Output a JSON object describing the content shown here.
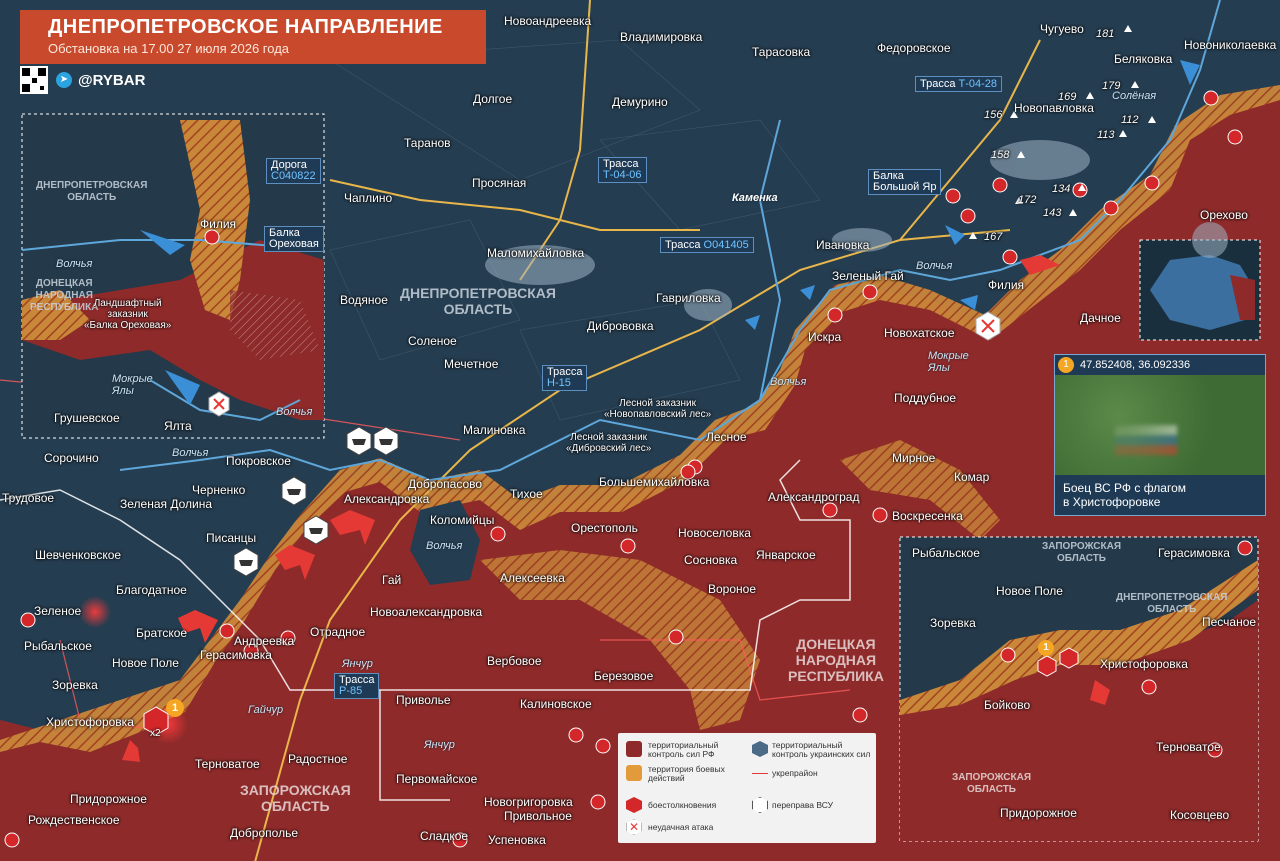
{
  "header": {
    "title": "ДНЕПРОПЕТРОВСКОЕ НАПРАВЛЕНИЕ",
    "subtitle": "Обстановка на 17.00 27 июля 2026 года",
    "brand": "@RYBAR",
    "telegram_icon": "telegram-icon"
  },
  "colors": {
    "ua_control": "#22394a",
    "ru_control": "#8e2a2a",
    "combat_zone": "#e39a3a",
    "accent": "#c8492b",
    "road": "#e8b64a",
    "river": "#5ea7da"
  },
  "regions": [
    {
      "id": "dnepr-main",
      "lines": [
        "ДНЕПРОПЕТРОВСКАЯ",
        "ОБЛАСТЬ"
      ]
    },
    {
      "id": "dnr-main",
      "lines": [
        "ДОНЕЦКАЯ",
        "НАРОДНАЯ",
        "РЕСПУБЛИКА"
      ]
    },
    {
      "id": "zap-main",
      "lines": [
        "ЗАПОРОЖСКАЯ",
        "ОБЛАСТЬ"
      ]
    },
    {
      "id": "inset1-dnepr",
      "lines": [
        "ДНЕПРОПЕТРОВСКАЯ",
        "ОБЛАСТЬ"
      ]
    },
    {
      "id": "inset1-dnr",
      "lines": [
        "ДОНЕЦКАЯ",
        "НАРОДНАЯ",
        "РЕСПУБЛИКА"
      ]
    },
    {
      "id": "inset3-zap-top",
      "lines": [
        "ЗАПОРОЖСКАЯ",
        "ОБЛАСТЬ"
      ]
    },
    {
      "id": "inset3-dnepr",
      "lines": [
        "ДНЕПРОПЕТРОВСКАЯ",
        "ОБЛАСТЬ"
      ]
    },
    {
      "id": "inset3-zap-bottom",
      "lines": [
        "ЗАПОРОЖСКАЯ",
        "ОБЛАСТЬ"
      ]
    }
  ],
  "roads": [
    {
      "name": "Трасса",
      "code": "Т-04-28"
    },
    {
      "name": "Трасса",
      "code": "Т-04-06"
    },
    {
      "name": "Трасса",
      "code": "О041405"
    },
    {
      "name": "Трасса",
      "code": "Н-15"
    },
    {
      "name": "Трасса",
      "code": "Р-85"
    },
    {
      "name": "Дорога",
      "code": "С040822"
    }
  ],
  "rivers": [
    "Каменка",
    "Волчья",
    "Волчья",
    "Мокрые Ялы",
    "Волчья",
    "Волчья",
    "Янчур",
    "Гайчур",
    "Янчур",
    "Солёная",
    "Волчья",
    "Мокрые Ялы",
    "Волчья"
  ],
  "settlements": {
    "main": [
      "Новоандреевка",
      "Владимировка",
      "Тарасовка",
      "Федоровское",
      "Чугуево",
      "Новониколаевка",
      "Беляковка",
      "Долгое",
      "Демурино",
      "Таранов",
      "Новопавловка",
      "Чаплино",
      "Просяная",
      "Орехово",
      "Маломихайловка",
      "Ивановка",
      "Зеленый Гай",
      "Гавриловка",
      "Филия",
      "Водяное",
      "Соленое",
      "Дибрововка",
      "Искра",
      "Новохатское",
      "Дачное",
      "Мечетное",
      "Поддубное",
      "Малиновка",
      "Лесное",
      "Мирное",
      "Комар",
      "Сорочино",
      "Покровское",
      "Добропасово",
      "Тихое",
      "Большемихайловка",
      "Черненко",
      "Александровка",
      "Коломийцы",
      "Орестополь",
      "Новоселовка",
      "Александроград",
      "Воскресенка",
      "Трудовое",
      "Зеленая Долина",
      "Писанцы",
      "Сосновка",
      "Январское",
      "Шевченковское",
      "Гай",
      "Алексеевка",
      "Вороное",
      "Благодатное",
      "Зеленое",
      "Новоалександровка",
      "Братское",
      "Андреевка",
      "Отрадное",
      "Рыбальское",
      "Новое Поле",
      "Герасимовка",
      "Вербовое",
      "Березовое",
      "Зоревка",
      "Приволье",
      "Калиновское",
      "Христофоровка",
      "Терноватое",
      "Радостное",
      "Первомайское",
      "Придорожное",
      "Новогригоровка",
      "Привольное",
      "Рождественское",
      "Доброполье",
      "Сладкое",
      "Успеновка",
      "Грушевское",
      "Ялта"
    ],
    "inset3": [
      "Рыбальское",
      "Герасимовка",
      "Новое Поле",
      "Песчаное",
      "Зоревка",
      "Христофоровка",
      "Бойково",
      "Терноватое",
      "Придорожное",
      "Косовцево"
    ]
  },
  "reserves": [
    {
      "lines": [
        "Лесной заказник",
        "«Новопавловский лес»"
      ]
    },
    {
      "lines": [
        "Лесной заказник",
        "«Дибровский лес»"
      ]
    },
    {
      "lines": [
        "Ландшафтный",
        "заказник",
        "«Балка Ореховая»"
      ]
    }
  ],
  "features": [
    {
      "lines": [
        "Балка",
        "Большой Яр"
      ]
    },
    {
      "lines": [
        "Балка",
        "Ореховая"
      ]
    }
  ],
  "heights": [
    "181",
    "179",
    "169",
    "156",
    "112",
    "113",
    "158",
    "172",
    "134",
    "143",
    "167"
  ],
  "photo": {
    "marker": "1",
    "coords": "47.852408, 36.092336",
    "caption_line1": "Боец ВС РФ с флагом",
    "caption_line2": "в Христофоровке"
  },
  "annotations": {
    "x2": "x2",
    "marker_1": "1"
  },
  "legend": {
    "items": [
      {
        "icon": "ru-control-swatch",
        "label": "территориальный контроль сил РФ"
      },
      {
        "icon": "ua-control-swatch",
        "label": "территориальный контроль украинских сил"
      },
      {
        "icon": "combat-zone-swatch",
        "label": "территория боевых действий"
      },
      {
        "icon": "fortification-line",
        "label": "укрепрайон"
      },
      {
        "icon": "clash-icon",
        "label": "боестолкновения"
      },
      {
        "icon": "crossing-icon",
        "label": "переправа ВСУ"
      },
      {
        "icon": "failed-attack-icon",
        "label": "неудачная атака"
      }
    ]
  }
}
